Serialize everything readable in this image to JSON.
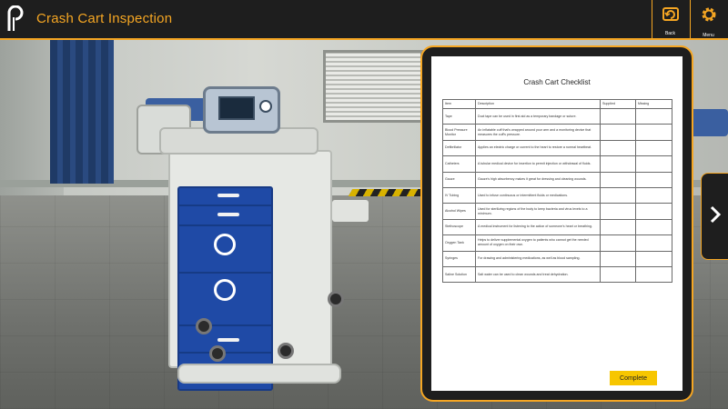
{
  "header": {
    "title": "Crash Cart Inspection",
    "back_label": "Back",
    "menu_label": "Menu"
  },
  "colors": {
    "accent": "#f5a623",
    "bar_background": "#1e1e1e",
    "complete_button": "#f7c600",
    "cart_drawer_blue": "#1f4aa6"
  },
  "icons": {
    "logo": "p-logo-icon",
    "back": "back-arrow-icon",
    "menu": "gear-icon",
    "next": "chevron-right-icon"
  },
  "checklist": {
    "title": "Crash Cart Checklist",
    "columns": [
      "Item",
      "Description",
      "Supplied",
      "Missing"
    ],
    "rows": [
      {
        "item": "Tape",
        "description": "Duct tape can be used in first aid as a temporary bandage or suture."
      },
      {
        "item": "Blood Pressure Monitor",
        "description": "An inflatable cuff that's wrapped around your arm and a monitoring device that measures the cuff's pressure."
      },
      {
        "item": "Defibrillator",
        "description": "Applies an electric charge or current to the heart to restore a normal heartbeat."
      },
      {
        "item": "Catheters",
        "description": "A tubular medical device for insertion to permit injection or withdrawal of fluids."
      },
      {
        "item": "Gauze",
        "description": "Gauze's high absorbency makes it great for dressing and cleaning wounds."
      },
      {
        "item": "IV Tubing",
        "description": "Used to infuse continuous or intermittent fluids or medications."
      },
      {
        "item": "Alcohol Wipes",
        "description": "Used for sterilizing regions of the body to keep bacteria and virus levels to a minimum."
      },
      {
        "item": "Stethoscope",
        "description": "A medical instrument for listening to the action of someone's heart or breathing."
      },
      {
        "item": "Oxygen Tank",
        "description": "Helps to deliver supplemental oxygen to patients who cannot get the needed amount of oxygen on their own."
      },
      {
        "item": "Syringes",
        "description": "For drawing and administering medications, as well as blood sampling."
      },
      {
        "item": "Saline Solution",
        "description": "Salt water can be used to clean wounds and treat dehydration."
      }
    ],
    "complete_label": "Complete"
  }
}
